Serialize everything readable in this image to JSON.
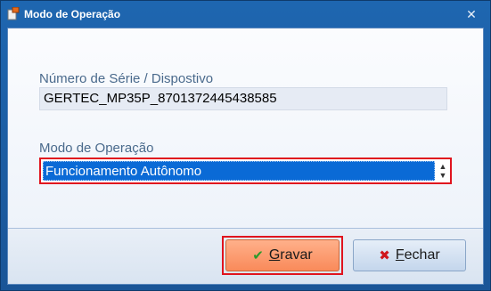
{
  "window": {
    "title": "Modo de Operação",
    "close_glyph": "✕"
  },
  "serial": {
    "label": "Número de Série / Dispostivo",
    "value": "GERTEC_MP35P_8701372445438585"
  },
  "mode": {
    "label": "Modo de Operação",
    "selected": "Funcionamento Autônomo"
  },
  "buttons": {
    "save_mnemonic": "G",
    "save_rest": "ravar",
    "close_mnemonic": "F",
    "close_rest": "echar"
  },
  "colors": {
    "highlight": "#e0141e",
    "selection": "#0a6ad6",
    "save_button": "#f98a5a",
    "titlebar": "#1e66b0"
  },
  "icons": {
    "app": "app-icon",
    "close": "close-icon",
    "spin": "spin-icon",
    "save": "checkmark-icon",
    "cancel": "x-icon"
  }
}
